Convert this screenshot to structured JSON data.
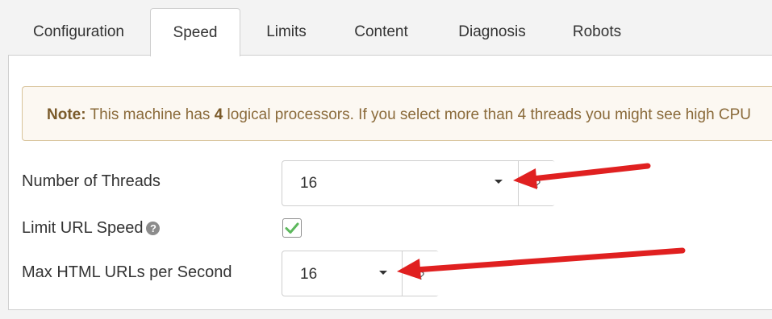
{
  "tabs": [
    {
      "label": "Configuration"
    },
    {
      "label": "Speed"
    },
    {
      "label": "Limits"
    },
    {
      "label": "Content"
    },
    {
      "label": "Diagnosis"
    },
    {
      "label": "Robots"
    }
  ],
  "note": {
    "prefix": "Note:",
    "text1": " This machine has ",
    "processors": "4",
    "text2": " logical processors. If you select more than 4 threads you might see high CPU"
  },
  "fields": {
    "threads": {
      "label": "Number of Threads",
      "value": "16",
      "help": "?"
    },
    "limit_speed": {
      "label": "Limit URL Speed",
      "checked": true,
      "help_icon": "question-circle-icon"
    },
    "max_html": {
      "label": "Max HTML URLs per Second",
      "value": "16",
      "help": "?"
    }
  },
  "colors": {
    "arrow": "#e02020",
    "checkmark": "#5cb85c",
    "note_bg": "#fcf8f2"
  }
}
